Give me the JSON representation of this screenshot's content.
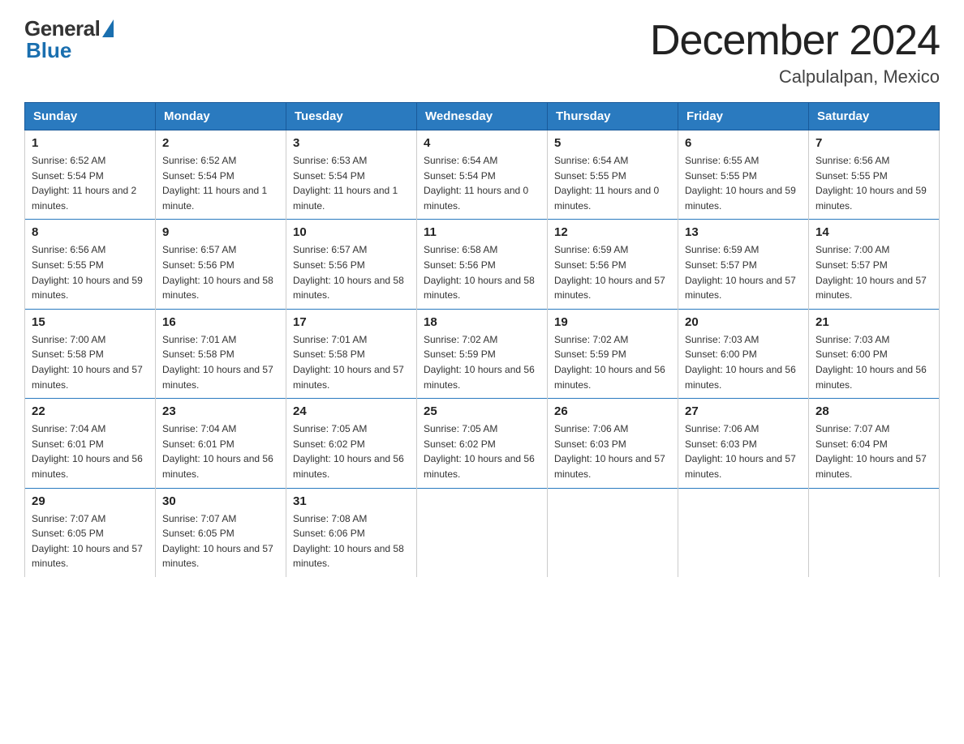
{
  "logo": {
    "text_general": "General",
    "text_blue": "Blue"
  },
  "header": {
    "month_title": "December 2024",
    "location": "Calpulalpan, Mexico"
  },
  "days_of_week": [
    "Sunday",
    "Monday",
    "Tuesday",
    "Wednesday",
    "Thursday",
    "Friday",
    "Saturday"
  ],
  "weeks": [
    [
      {
        "day": "1",
        "sunrise": "6:52 AM",
        "sunset": "5:54 PM",
        "daylight": "11 hours and 2 minutes."
      },
      {
        "day": "2",
        "sunrise": "6:52 AM",
        "sunset": "5:54 PM",
        "daylight": "11 hours and 1 minute."
      },
      {
        "day": "3",
        "sunrise": "6:53 AM",
        "sunset": "5:54 PM",
        "daylight": "11 hours and 1 minute."
      },
      {
        "day": "4",
        "sunrise": "6:54 AM",
        "sunset": "5:54 PM",
        "daylight": "11 hours and 0 minutes."
      },
      {
        "day": "5",
        "sunrise": "6:54 AM",
        "sunset": "5:55 PM",
        "daylight": "11 hours and 0 minutes."
      },
      {
        "day": "6",
        "sunrise": "6:55 AM",
        "sunset": "5:55 PM",
        "daylight": "10 hours and 59 minutes."
      },
      {
        "day": "7",
        "sunrise": "6:56 AM",
        "sunset": "5:55 PM",
        "daylight": "10 hours and 59 minutes."
      }
    ],
    [
      {
        "day": "8",
        "sunrise": "6:56 AM",
        "sunset": "5:55 PM",
        "daylight": "10 hours and 59 minutes."
      },
      {
        "day": "9",
        "sunrise": "6:57 AM",
        "sunset": "5:56 PM",
        "daylight": "10 hours and 58 minutes."
      },
      {
        "day": "10",
        "sunrise": "6:57 AM",
        "sunset": "5:56 PM",
        "daylight": "10 hours and 58 minutes."
      },
      {
        "day": "11",
        "sunrise": "6:58 AM",
        "sunset": "5:56 PM",
        "daylight": "10 hours and 58 minutes."
      },
      {
        "day": "12",
        "sunrise": "6:59 AM",
        "sunset": "5:56 PM",
        "daylight": "10 hours and 57 minutes."
      },
      {
        "day": "13",
        "sunrise": "6:59 AM",
        "sunset": "5:57 PM",
        "daylight": "10 hours and 57 minutes."
      },
      {
        "day": "14",
        "sunrise": "7:00 AM",
        "sunset": "5:57 PM",
        "daylight": "10 hours and 57 minutes."
      }
    ],
    [
      {
        "day": "15",
        "sunrise": "7:00 AM",
        "sunset": "5:58 PM",
        "daylight": "10 hours and 57 minutes."
      },
      {
        "day": "16",
        "sunrise": "7:01 AM",
        "sunset": "5:58 PM",
        "daylight": "10 hours and 57 minutes."
      },
      {
        "day": "17",
        "sunrise": "7:01 AM",
        "sunset": "5:58 PM",
        "daylight": "10 hours and 57 minutes."
      },
      {
        "day": "18",
        "sunrise": "7:02 AM",
        "sunset": "5:59 PM",
        "daylight": "10 hours and 56 minutes."
      },
      {
        "day": "19",
        "sunrise": "7:02 AM",
        "sunset": "5:59 PM",
        "daylight": "10 hours and 56 minutes."
      },
      {
        "day": "20",
        "sunrise": "7:03 AM",
        "sunset": "6:00 PM",
        "daylight": "10 hours and 56 minutes."
      },
      {
        "day": "21",
        "sunrise": "7:03 AM",
        "sunset": "6:00 PM",
        "daylight": "10 hours and 56 minutes."
      }
    ],
    [
      {
        "day": "22",
        "sunrise": "7:04 AM",
        "sunset": "6:01 PM",
        "daylight": "10 hours and 56 minutes."
      },
      {
        "day": "23",
        "sunrise": "7:04 AM",
        "sunset": "6:01 PM",
        "daylight": "10 hours and 56 minutes."
      },
      {
        "day": "24",
        "sunrise": "7:05 AM",
        "sunset": "6:02 PM",
        "daylight": "10 hours and 56 minutes."
      },
      {
        "day": "25",
        "sunrise": "7:05 AM",
        "sunset": "6:02 PM",
        "daylight": "10 hours and 56 minutes."
      },
      {
        "day": "26",
        "sunrise": "7:06 AM",
        "sunset": "6:03 PM",
        "daylight": "10 hours and 57 minutes."
      },
      {
        "day": "27",
        "sunrise": "7:06 AM",
        "sunset": "6:03 PM",
        "daylight": "10 hours and 57 minutes."
      },
      {
        "day": "28",
        "sunrise": "7:07 AM",
        "sunset": "6:04 PM",
        "daylight": "10 hours and 57 minutes."
      }
    ],
    [
      {
        "day": "29",
        "sunrise": "7:07 AM",
        "sunset": "6:05 PM",
        "daylight": "10 hours and 57 minutes."
      },
      {
        "day": "30",
        "sunrise": "7:07 AM",
        "sunset": "6:05 PM",
        "daylight": "10 hours and 57 minutes."
      },
      {
        "day": "31",
        "sunrise": "7:08 AM",
        "sunset": "6:06 PM",
        "daylight": "10 hours and 58 minutes."
      },
      null,
      null,
      null,
      null
    ]
  ],
  "colors": {
    "header_bg": "#2a7abf",
    "accent": "#1a6faf"
  }
}
